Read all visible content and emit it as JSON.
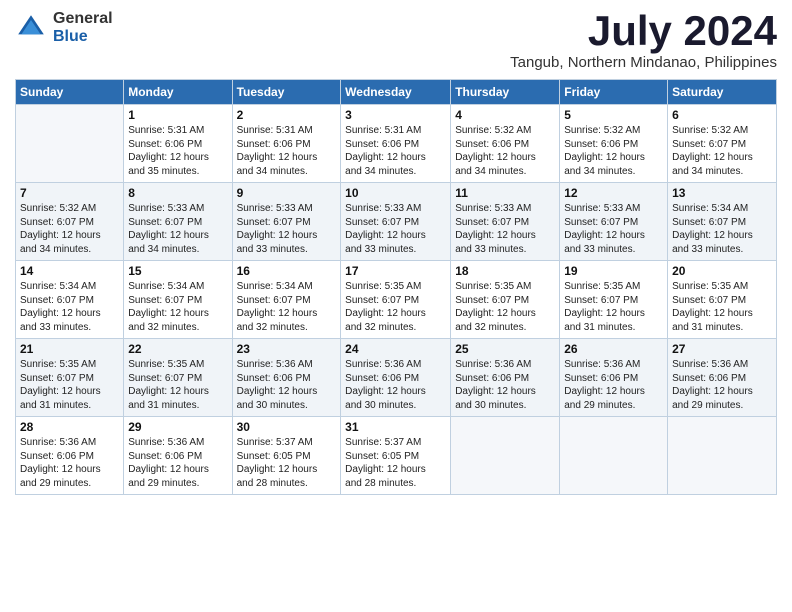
{
  "logo": {
    "general": "General",
    "blue": "Blue"
  },
  "title": "July 2024",
  "subtitle": "Tangub, Northern Mindanao, Philippines",
  "days_of_week": [
    "Sunday",
    "Monday",
    "Tuesday",
    "Wednesday",
    "Thursday",
    "Friday",
    "Saturday"
  ],
  "weeks": [
    [
      {
        "day": "",
        "info": ""
      },
      {
        "day": "1",
        "info": "Sunrise: 5:31 AM\nSunset: 6:06 PM\nDaylight: 12 hours\nand 35 minutes."
      },
      {
        "day": "2",
        "info": "Sunrise: 5:31 AM\nSunset: 6:06 PM\nDaylight: 12 hours\nand 34 minutes."
      },
      {
        "day": "3",
        "info": "Sunrise: 5:31 AM\nSunset: 6:06 PM\nDaylight: 12 hours\nand 34 minutes."
      },
      {
        "day": "4",
        "info": "Sunrise: 5:32 AM\nSunset: 6:06 PM\nDaylight: 12 hours\nand 34 minutes."
      },
      {
        "day": "5",
        "info": "Sunrise: 5:32 AM\nSunset: 6:06 PM\nDaylight: 12 hours\nand 34 minutes."
      },
      {
        "day": "6",
        "info": "Sunrise: 5:32 AM\nSunset: 6:07 PM\nDaylight: 12 hours\nand 34 minutes."
      }
    ],
    [
      {
        "day": "7",
        "info": "Sunrise: 5:32 AM\nSunset: 6:07 PM\nDaylight: 12 hours\nand 34 minutes."
      },
      {
        "day": "8",
        "info": "Sunrise: 5:33 AM\nSunset: 6:07 PM\nDaylight: 12 hours\nand 34 minutes."
      },
      {
        "day": "9",
        "info": "Sunrise: 5:33 AM\nSunset: 6:07 PM\nDaylight: 12 hours\nand 33 minutes."
      },
      {
        "day": "10",
        "info": "Sunrise: 5:33 AM\nSunset: 6:07 PM\nDaylight: 12 hours\nand 33 minutes."
      },
      {
        "day": "11",
        "info": "Sunrise: 5:33 AM\nSunset: 6:07 PM\nDaylight: 12 hours\nand 33 minutes."
      },
      {
        "day": "12",
        "info": "Sunrise: 5:33 AM\nSunset: 6:07 PM\nDaylight: 12 hours\nand 33 minutes."
      },
      {
        "day": "13",
        "info": "Sunrise: 5:34 AM\nSunset: 6:07 PM\nDaylight: 12 hours\nand 33 minutes."
      }
    ],
    [
      {
        "day": "14",
        "info": "Sunrise: 5:34 AM\nSunset: 6:07 PM\nDaylight: 12 hours\nand 33 minutes."
      },
      {
        "day": "15",
        "info": "Sunrise: 5:34 AM\nSunset: 6:07 PM\nDaylight: 12 hours\nand 32 minutes."
      },
      {
        "day": "16",
        "info": "Sunrise: 5:34 AM\nSunset: 6:07 PM\nDaylight: 12 hours\nand 32 minutes."
      },
      {
        "day": "17",
        "info": "Sunrise: 5:35 AM\nSunset: 6:07 PM\nDaylight: 12 hours\nand 32 minutes."
      },
      {
        "day": "18",
        "info": "Sunrise: 5:35 AM\nSunset: 6:07 PM\nDaylight: 12 hours\nand 32 minutes."
      },
      {
        "day": "19",
        "info": "Sunrise: 5:35 AM\nSunset: 6:07 PM\nDaylight: 12 hours\nand 31 minutes."
      },
      {
        "day": "20",
        "info": "Sunrise: 5:35 AM\nSunset: 6:07 PM\nDaylight: 12 hours\nand 31 minutes."
      }
    ],
    [
      {
        "day": "21",
        "info": "Sunrise: 5:35 AM\nSunset: 6:07 PM\nDaylight: 12 hours\nand 31 minutes."
      },
      {
        "day": "22",
        "info": "Sunrise: 5:35 AM\nSunset: 6:07 PM\nDaylight: 12 hours\nand 31 minutes."
      },
      {
        "day": "23",
        "info": "Sunrise: 5:36 AM\nSunset: 6:06 PM\nDaylight: 12 hours\nand 30 minutes."
      },
      {
        "day": "24",
        "info": "Sunrise: 5:36 AM\nSunset: 6:06 PM\nDaylight: 12 hours\nand 30 minutes."
      },
      {
        "day": "25",
        "info": "Sunrise: 5:36 AM\nSunset: 6:06 PM\nDaylight: 12 hours\nand 30 minutes."
      },
      {
        "day": "26",
        "info": "Sunrise: 5:36 AM\nSunset: 6:06 PM\nDaylight: 12 hours\nand 29 minutes."
      },
      {
        "day": "27",
        "info": "Sunrise: 5:36 AM\nSunset: 6:06 PM\nDaylight: 12 hours\nand 29 minutes."
      }
    ],
    [
      {
        "day": "28",
        "info": "Sunrise: 5:36 AM\nSunset: 6:06 PM\nDaylight: 12 hours\nand 29 minutes."
      },
      {
        "day": "29",
        "info": "Sunrise: 5:36 AM\nSunset: 6:06 PM\nDaylight: 12 hours\nand 29 minutes."
      },
      {
        "day": "30",
        "info": "Sunrise: 5:37 AM\nSunset: 6:05 PM\nDaylight: 12 hours\nand 28 minutes."
      },
      {
        "day": "31",
        "info": "Sunrise: 5:37 AM\nSunset: 6:05 PM\nDaylight: 12 hours\nand 28 minutes."
      },
      {
        "day": "",
        "info": ""
      },
      {
        "day": "",
        "info": ""
      },
      {
        "day": "",
        "info": ""
      }
    ]
  ]
}
